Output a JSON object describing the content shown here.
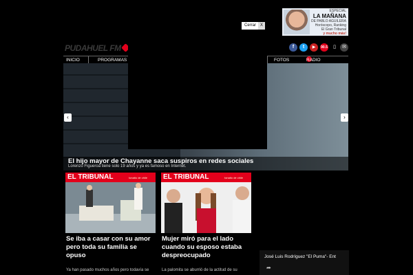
{
  "promo": {
    "line1": "ESPECIAL",
    "line2": "LA MAÑANA",
    "line3": "DE PABLO AGUILERA",
    "line4": "Horóscopo, Ranking",
    "line5": "El Gran Tribunal",
    "line6": "y mucho más!"
  },
  "close_button": {
    "label": "Cerrar",
    "x": "X"
  },
  "logo": "PUDAHUEL FM",
  "social": {
    "facebook": "f",
    "twitter": "t",
    "youtube": "▶",
    "freq": "90.5",
    "phone": "▯",
    "mail": "✉"
  },
  "nav": {
    "inicio": "INICIO",
    "programas": "PROGRAMAS",
    "truncated": "N",
    "fotos": "FOTOS",
    "radio": "RADIO ON LINE"
  },
  "hero": {
    "title": "El hijo mayor de Chayanne saca suspiros en redes sociales",
    "subtitle": "Lorenzo Figueroa tiene solo 19 años y ya es famoso en Internet.",
    "prev": "‹",
    "next": "›"
  },
  "articles": [
    {
      "badge": "EL TRIBUNAL",
      "badge_sub": "tonatio de chile",
      "title": "Se iba a casar con su amor pero toda su familia se opuso",
      "summary": "Ya han pasado muchos años pero todavía se"
    },
    {
      "badge": "EL TRIBUNAL",
      "badge_sub": "tonatio de chile",
      "title": "Mujer miró para el lado cuando su esposo estaba despreocupado",
      "summary": "La palomita se aburrió de la actitud de su"
    }
  ],
  "video": {
    "title": "José Luis Rodríguez \"El Puma\"- Ent",
    "share": "➦"
  }
}
